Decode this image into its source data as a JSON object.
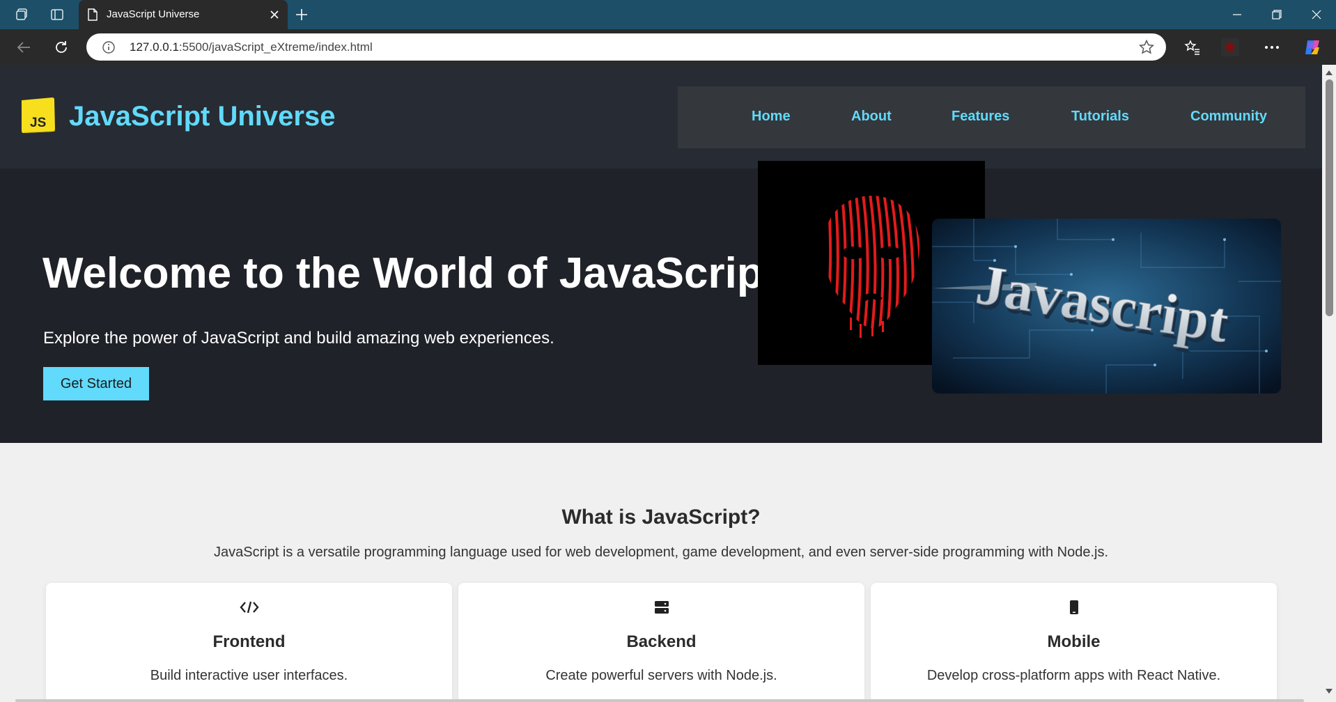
{
  "browser": {
    "tab_title": "JavaScript Universe",
    "url_host": "127.0.0.1",
    "url_rest": ":5500/javaScript_eXtreme/index.html"
  },
  "site": {
    "logo_text": "JS",
    "brand": "JavaScript Universe",
    "nav": [
      "Home",
      "About",
      "Features",
      "Tutorials",
      "Community"
    ]
  },
  "hero": {
    "title": "Welcome to the World of JavaScript",
    "subtitle": "Explore the power of JavaScript and build amazing web experiences.",
    "cta_label": "Get Started",
    "image_text": "Javascript"
  },
  "about": {
    "title": "What is JavaScript?",
    "lead": "JavaScript is a versatile programming language used for web development, game development, and even server-side programming with Node.js.",
    "cards": [
      {
        "icon": "code-icon",
        "title": "Frontend",
        "text": "Build interactive user interfaces."
      },
      {
        "icon": "server-icon",
        "title": "Backend",
        "text": "Create powerful servers with Node.js."
      },
      {
        "icon": "mobile-icon",
        "title": "Mobile",
        "text": "Develop cross-platform apps with React Native."
      }
    ]
  },
  "colors": {
    "accent": "#61dafb",
    "header_bg": "#272b33",
    "hero_bg": "#1f2228",
    "logo_yellow": "#f7df1e",
    "tabbar": "#1d5068"
  }
}
